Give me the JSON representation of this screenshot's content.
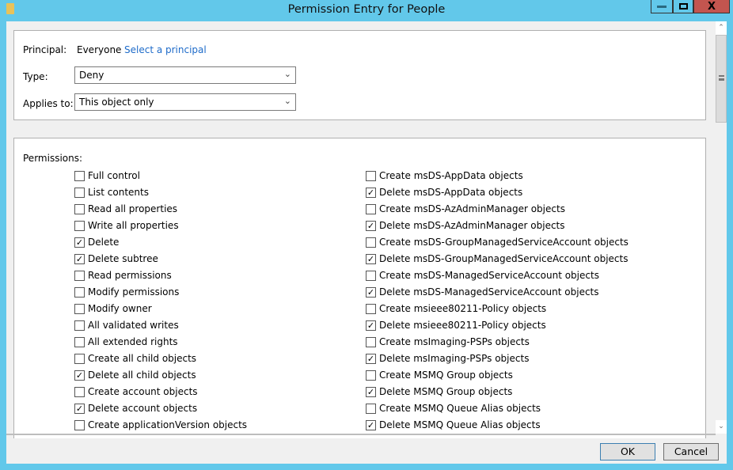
{
  "window": {
    "title": "Permission Entry for People",
    "minimize": "minimize",
    "maximize": "maximize",
    "close": "X"
  },
  "principal": {
    "label": "Principal:",
    "value": "Everyone",
    "link": "Select a principal"
  },
  "type": {
    "label": "Type:",
    "value": "Deny"
  },
  "applies": {
    "label": "Applies to:",
    "value": "This object only"
  },
  "permissions": {
    "label": "Permissions:",
    "left": [
      {
        "label": "Full control",
        "checked": false
      },
      {
        "label": "List contents",
        "checked": false
      },
      {
        "label": "Read all properties",
        "checked": false
      },
      {
        "label": "Write all properties",
        "checked": false
      },
      {
        "label": "Delete",
        "checked": true
      },
      {
        "label": "Delete subtree",
        "checked": true
      },
      {
        "label": "Read permissions",
        "checked": false
      },
      {
        "label": "Modify permissions",
        "checked": false
      },
      {
        "label": "Modify owner",
        "checked": false
      },
      {
        "label": "All validated writes",
        "checked": false
      },
      {
        "label": "All extended rights",
        "checked": false
      },
      {
        "label": "Create all child objects",
        "checked": false
      },
      {
        "label": "Delete all child objects",
        "checked": true
      },
      {
        "label": "Create account objects",
        "checked": false
      },
      {
        "label": "Delete account objects",
        "checked": true
      },
      {
        "label": "Create applicationVersion objects",
        "checked": false
      }
    ],
    "right": [
      {
        "label": "Create msDS-AppData objects",
        "checked": false
      },
      {
        "label": "Delete msDS-AppData objects",
        "checked": true
      },
      {
        "label": "Create msDS-AzAdminManager objects",
        "checked": false
      },
      {
        "label": "Delete msDS-AzAdminManager objects",
        "checked": true
      },
      {
        "label": "Create msDS-GroupManagedServiceAccount objects",
        "checked": false
      },
      {
        "label": "Delete msDS-GroupManagedServiceAccount objects",
        "checked": true
      },
      {
        "label": "Create msDS-ManagedServiceAccount objects",
        "checked": false
      },
      {
        "label": "Delete msDS-ManagedServiceAccount objects",
        "checked": true
      },
      {
        "label": "Create msieee80211-Policy objects",
        "checked": false
      },
      {
        "label": "Delete msieee80211-Policy objects",
        "checked": true
      },
      {
        "label": "Create msImaging-PSPs objects",
        "checked": false
      },
      {
        "label": "Delete msImaging-PSPs objects",
        "checked": true
      },
      {
        "label": "Create MSMQ Group objects",
        "checked": false
      },
      {
        "label": "Delete MSMQ Group objects",
        "checked": true
      },
      {
        "label": "Create MSMQ Queue Alias objects",
        "checked": false
      },
      {
        "label": "Delete MSMQ Queue Alias objects",
        "checked": true
      }
    ]
  },
  "buttons": {
    "ok": "OK",
    "cancel": "Cancel"
  }
}
